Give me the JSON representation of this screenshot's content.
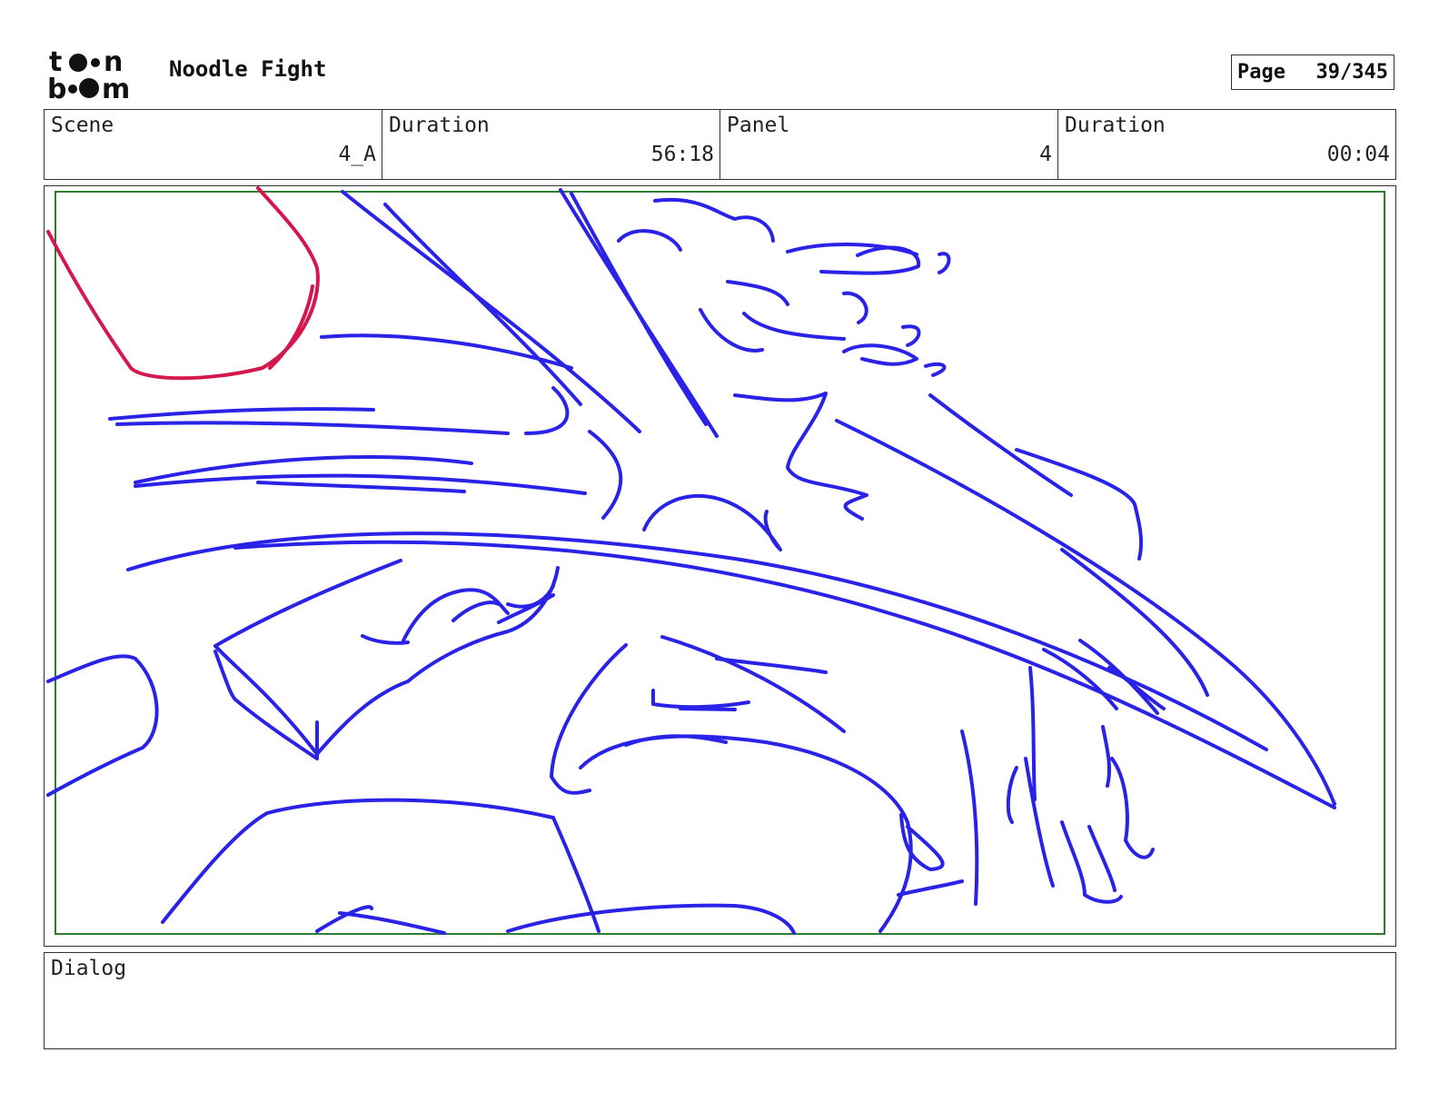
{
  "header": {
    "logo_text": "toon boom",
    "title": "Noodle Fight",
    "page_label": "Page",
    "page_value": "39/345"
  },
  "info": {
    "scene_label": "Scene",
    "scene_value": "4_A",
    "duration_label": "Duration",
    "duration_value": "56:18",
    "panel_label": "Panel",
    "panel_value": "4",
    "panel_duration_label": "Duration",
    "panel_duration_value": "00:04"
  },
  "panel": {
    "sketch_color": "#2a22e6",
    "highlight_color": "#d4174d",
    "safe_frame_color": "#2e7d32"
  },
  "dialog": {
    "label": "Dialog"
  }
}
